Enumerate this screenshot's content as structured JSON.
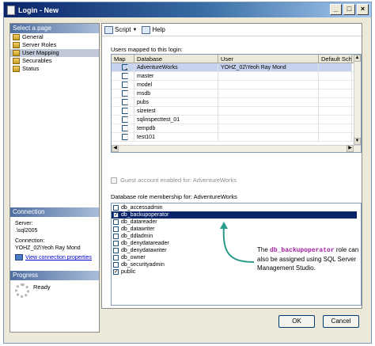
{
  "window": {
    "title": "Login - New"
  },
  "sidebar": {
    "header": "Select a page",
    "items": [
      {
        "label": "General"
      },
      {
        "label": "Server Roles"
      },
      {
        "label": "User Mapping"
      },
      {
        "label": "Securables"
      },
      {
        "label": "Status"
      }
    ],
    "selected": "User Mapping"
  },
  "connection": {
    "header": "Connection",
    "server_label": "Server:",
    "server_value": ".\\sql2005",
    "conn_label": "Connection:",
    "conn_value": "YOHZ_02\\Yeoh Ray Mond",
    "link": "View connection properties"
  },
  "progress": {
    "header": "Progress",
    "status": "Ready"
  },
  "toolbar": {
    "script_label": "Script",
    "help_label": "Help"
  },
  "mapping": {
    "label": "Users mapped to this login:",
    "columns": [
      "Map",
      "Database",
      "User",
      "Default Sche"
    ],
    "rows": [
      {
        "map": true,
        "database": "AdventureWorks",
        "user": "YOHZ_02\\Yeoh Ray Mond"
      },
      {
        "map": false,
        "database": "master",
        "user": ""
      },
      {
        "map": false,
        "database": "model",
        "user": ""
      },
      {
        "map": false,
        "database": "msdb",
        "user": ""
      },
      {
        "map": false,
        "database": "pubs",
        "user": ""
      },
      {
        "map": false,
        "database": "sizetest",
        "user": ""
      },
      {
        "map": false,
        "database": "sqlinspecttest_01",
        "user": ""
      },
      {
        "map": false,
        "database": "tempdb",
        "user": ""
      },
      {
        "map": false,
        "database": "test101",
        "user": ""
      }
    ]
  },
  "guest_label": "Guest account enabled for: AdventureWorks",
  "roles": {
    "label": "Database role membership for: AdventureWorks",
    "items": [
      {
        "name": "db_accessadmin",
        "checked": false
      },
      {
        "name": "db_backupoperator",
        "checked": true,
        "selected": true
      },
      {
        "name": "db_datareader",
        "checked": false
      },
      {
        "name": "db_datawriter",
        "checked": false
      },
      {
        "name": "db_ddladmin",
        "checked": false
      },
      {
        "name": "db_denydatareader",
        "checked": false
      },
      {
        "name": "db_denydatawriter",
        "checked": false
      },
      {
        "name": "db_owner",
        "checked": false
      },
      {
        "name": "db_securityadmin",
        "checked": false
      },
      {
        "name": "public",
        "checked": true
      }
    ]
  },
  "callout": {
    "pre": "The ",
    "highlight": "db_backupoperator",
    "post": " role can also be assigned using SQL Server Management Studio."
  },
  "buttons": {
    "ok": "OK",
    "cancel": "Cancel"
  }
}
